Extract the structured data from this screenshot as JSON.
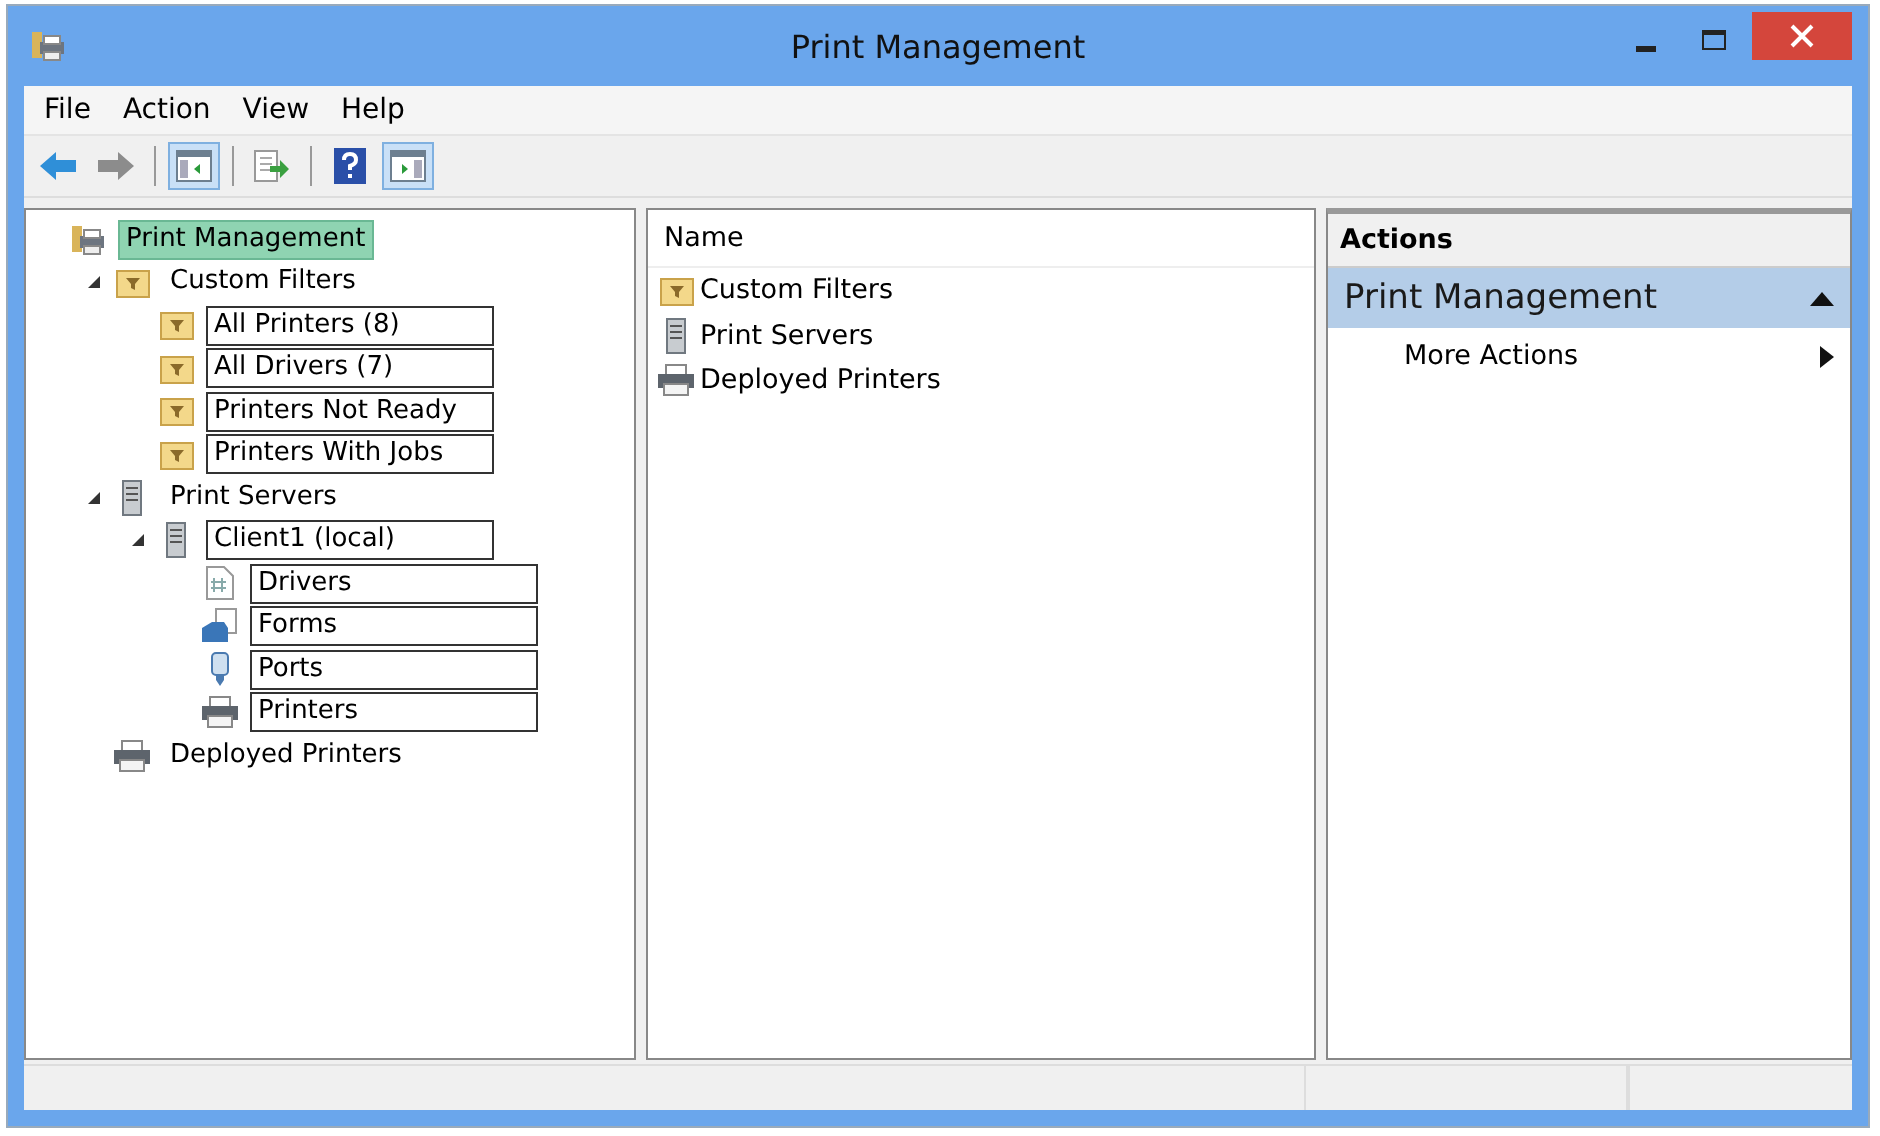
{
  "window": {
    "title": "Print Management"
  },
  "menu": [
    {
      "label": "File"
    },
    {
      "label": "Action"
    },
    {
      "label": "View"
    },
    {
      "label": "Help"
    }
  ],
  "toolbar": [
    {
      "kind": "back",
      "pressed": false
    },
    {
      "kind": "forward",
      "pressed": false
    },
    {
      "kind": "tree-pane",
      "pressed": true
    },
    {
      "kind": "export",
      "pressed": false
    },
    {
      "kind": "help",
      "pressed": false
    },
    {
      "kind": "action-pane",
      "pressed": true
    }
  ],
  "tree": [
    {
      "label": "Print Management",
      "kind": "console",
      "selected": true,
      "outlined": false,
      "children": [
        {
          "label": "Custom Filters",
          "kind": "filter-folder",
          "selected": false,
          "outlined": false,
          "expanded": true,
          "children": [
            {
              "label": "All Printers (8)",
              "kind": "filter-folder",
              "selected": false,
              "outlined": true
            },
            {
              "label": "All Drivers (7)",
              "kind": "filter-folder",
              "selected": false,
              "outlined": true
            },
            {
              "label": "Printers Not Ready",
              "kind": "filter-folder",
              "selected": false,
              "outlined": true
            },
            {
              "label": "Printers With Jobs",
              "kind": "filter-folder",
              "selected": false,
              "outlined": true
            }
          ]
        },
        {
          "label": "Print Servers",
          "kind": "server",
          "selected": false,
          "outlined": false,
          "expanded": true,
          "children": [
            {
              "label": "Client1 (local)",
              "kind": "server",
              "selected": false,
              "outlined": true,
              "expanded": true,
              "children": [
                {
                  "label": "Drivers",
                  "kind": "drivers",
                  "selected": false,
                  "outlined": true
                },
                {
                  "label": "Forms",
                  "kind": "forms",
                  "selected": false,
                  "outlined": true
                },
                {
                  "label": "Ports",
                  "kind": "ports",
                  "selected": false,
                  "outlined": true
                },
                {
                  "label": "Printers",
                  "kind": "printer",
                  "selected": false,
                  "outlined": true
                }
              ]
            }
          ]
        },
        {
          "label": "Deployed Printers",
          "kind": "printer",
          "selected": false,
          "outlined": false
        }
      ]
    }
  ],
  "list": {
    "column": "Name",
    "items": [
      {
        "label": "Custom Filters",
        "kind": "filter-folder"
      },
      {
        "label": "Print Servers",
        "kind": "server"
      },
      {
        "label": "Deployed Printers",
        "kind": "printer"
      }
    ]
  },
  "actions": {
    "title": "Actions",
    "section": {
      "label": "Print Management",
      "expanded": true
    },
    "items": [
      {
        "label": "More Actions",
        "submenu": true
      }
    ]
  }
}
